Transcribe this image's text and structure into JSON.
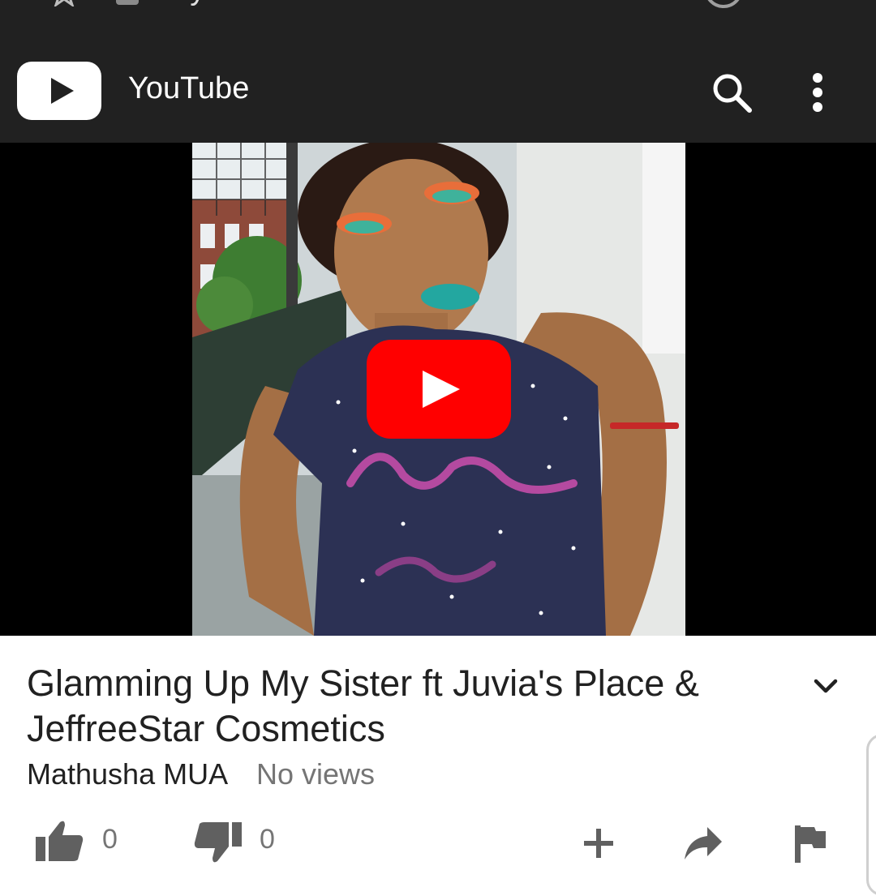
{
  "browser": {
    "url": "m.youtube.com"
  },
  "app": {
    "title": "YouTube",
    "logo_icon": "youtube-logo-icon",
    "search_icon": "search-icon",
    "menu_icon": "more-vert-icon"
  },
  "video": {
    "title_line1": "Glamming Up My Sister ft Juvia's Place &",
    "title_line2": "JeffreeStar Cosmetics",
    "channel": "Mathusha MUA",
    "views": "No views",
    "play_icon": "play-icon"
  },
  "actions": {
    "like_count": "0",
    "dislike_count": "0",
    "like_icon": "thumb-up-icon",
    "dislike_icon": "thumb-down-icon",
    "add_icon": "add-icon",
    "share_icon": "share-icon",
    "flag_icon": "flag-icon"
  },
  "colors": {
    "appbar": "#212121",
    "play_button": "#ff0000",
    "text_primary": "#212121",
    "text_secondary": "#757575",
    "icon": "#606060"
  }
}
